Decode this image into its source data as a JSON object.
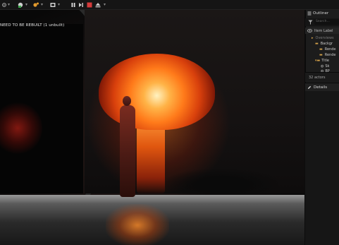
{
  "toolbar": {
    "play": "play-icon",
    "pause": "pause-icon",
    "stop": "stop-icon",
    "eject": "eject-icon",
    "colors": {
      "play": "#e0e0e0",
      "stop": "#d43a3a",
      "bg": "#151515"
    }
  },
  "viewport": {
    "warning": "NEED TO BE REBUILT (1 unbuilt)"
  },
  "outliner": {
    "title": "Outliner",
    "search_placeholder": "Search...",
    "column_label": "Item Label",
    "items": [
      {
        "label": "Overviews"
      },
      {
        "label": "Backgr"
      },
      {
        "label": "Rende"
      },
      {
        "label": "Rende"
      },
      {
        "label": "Title"
      },
      {
        "label": "Sk"
      },
      {
        "label": "BP_"
      }
    ],
    "count": "32 actors"
  },
  "details": {
    "title": "Details"
  }
}
